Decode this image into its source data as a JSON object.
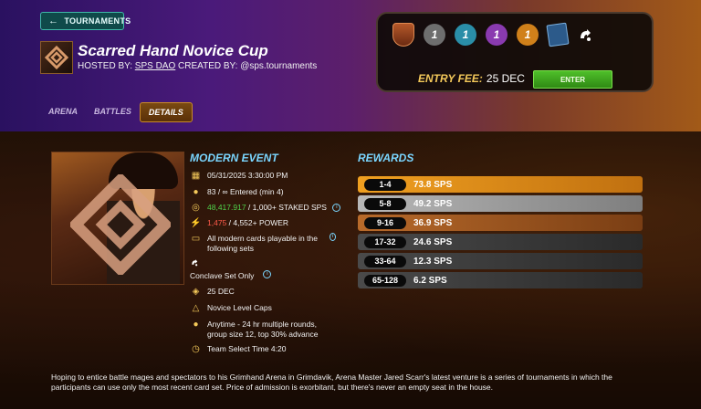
{
  "header": {
    "back_label": "TOURNAMENTS",
    "title": "Scarred Hand Novice Cup",
    "hosted_label": "HOSTED BY:",
    "host": "SPS DAO",
    "created_label": "CREATED BY:",
    "creator": "@sps.tournaments"
  },
  "tabs": [
    {
      "label": "ARENA",
      "active": false
    },
    {
      "label": "BATTLES",
      "active": false
    },
    {
      "label": "DETAILS",
      "active": true
    }
  ],
  "entry": {
    "badges": [
      {
        "icon": "league-shield-icon",
        "value": ""
      },
      {
        "icon": "common-rarity-icon",
        "value": "1",
        "color": "#6e6e6e"
      },
      {
        "icon": "rare-rarity-icon",
        "value": "1",
        "color": "#2a8ea8"
      },
      {
        "icon": "epic-rarity-icon",
        "value": "1",
        "color": "#8a3ab0"
      },
      {
        "icon": "legendary-rarity-icon",
        "value": "1",
        "color": "#d0801a"
      },
      {
        "icon": "card-set-icon",
        "value": ""
      },
      {
        "icon": "conclave-icon",
        "value": ""
      }
    ],
    "fee_label": "ENTRY FEE:",
    "fee_value": "25 DEC",
    "enter_label": "ENTER"
  },
  "event": {
    "title": "MODERN EVENT",
    "date": "05/31/2025 3:30:00 PM",
    "entered": "83 / ∞ Entered (min 4)",
    "staked_value": "48,417.917",
    "staked_req": " / 1,000+ STAKED SPS",
    "power_value": "1,475",
    "power_req": " / 4,552+ POWER",
    "cards_line": "All modern cards playable in the following sets",
    "set_only": "Conclave Set Only",
    "fee": "25 DEC",
    "level_caps": "Novice Level Caps",
    "rounds": "Anytime - 24 hr multiple rounds, group size 12, top 30% advance",
    "team_time": "Team Select Time 4:20"
  },
  "rewards": {
    "title": "REWARDS",
    "rows": [
      {
        "rank": "1-4",
        "prize": "73.8 SPS",
        "tier": "gold"
      },
      {
        "rank": "5-8",
        "prize": "49.2 SPS",
        "tier": "silver"
      },
      {
        "rank": "9-16",
        "prize": "36.9 SPS",
        "tier": "bronze"
      },
      {
        "rank": "17-32",
        "prize": "24.6 SPS",
        "tier": "dark"
      },
      {
        "rank": "33-64",
        "prize": "12.3 SPS",
        "tier": "dark"
      },
      {
        "rank": "65-128",
        "prize": "6.2 SPS",
        "tier": "dark"
      }
    ]
  },
  "description": "Hoping to entice battle mages and spectators to his Grimhand Arena in Grimdavik, Arena Master Jared Scarr's latest venture is a series of tournaments in which the participants can use only the most recent card set. Price of admission is exorbitant, but there's never an empty seat in the house."
}
